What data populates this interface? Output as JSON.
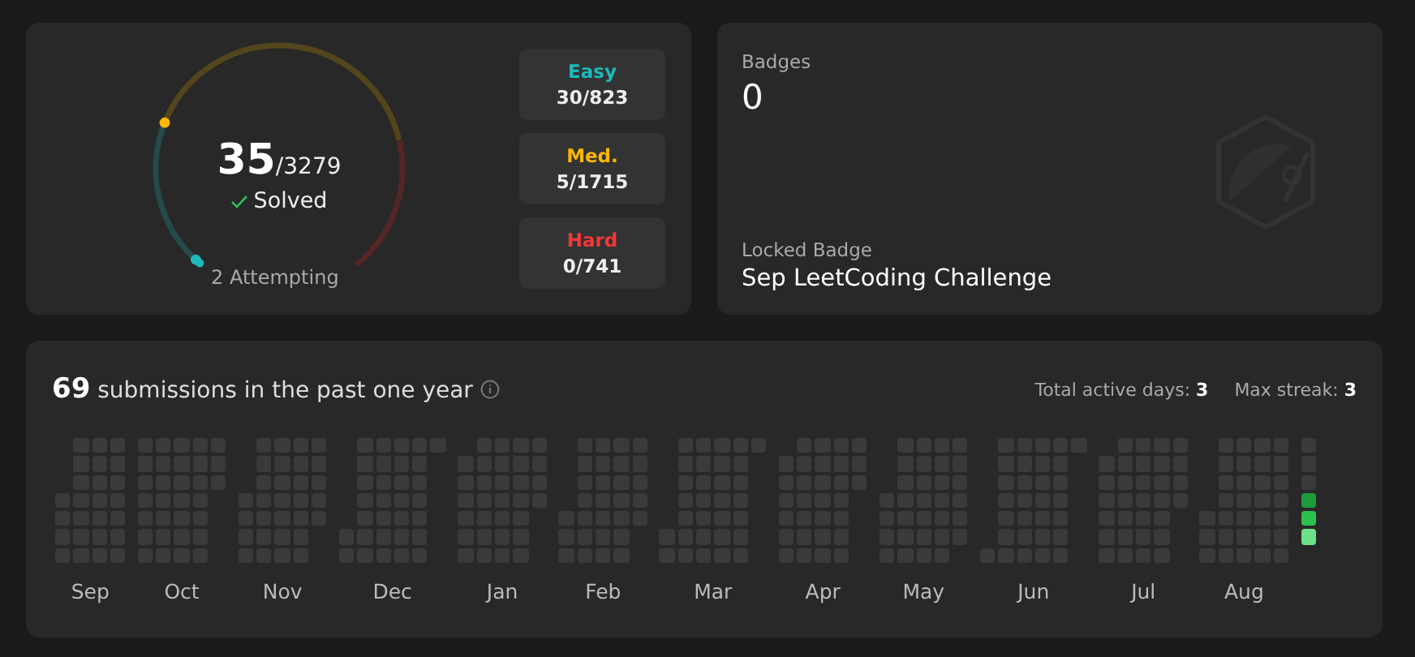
{
  "solved": {
    "count": "35",
    "total": "/3279",
    "label": "Solved",
    "attempting": "2 Attempting",
    "difficulties": [
      {
        "kind": "easy",
        "label": "Easy",
        "value": "30/823"
      },
      {
        "kind": "medium",
        "label": "Med.",
        "value": "5/1715"
      },
      {
        "kind": "hard",
        "label": "Hard",
        "value": "0/741"
      }
    ]
  },
  "badges": {
    "title": "Badges",
    "count": "0",
    "locked_label": "Locked Badge",
    "locked_name": "Sep LeetCoding Challenge"
  },
  "calendar": {
    "title": "**69** submissions in the past one year",
    "total_active": "Total active days: **3**",
    "max_streak": "Max streak: **3**",
    "months": [
      {
        "label": "Sep"
      },
      {
        "label": "Oct"
      },
      {
        "label": "Nov"
      },
      {
        "label": "Dec"
      },
      {
        "label": "Jan"
      },
      {
        "label": "Feb"
      },
      {
        "label": "Mar"
      },
      {
        "label": "Apr"
      },
      {
        "label": "May"
      },
      {
        "label": "Jun"
      },
      {
        "label": "Jul"
      },
      {
        "label": "Aug"
      }
    ],
    "active_days": [
      {
        "color": "#1c9a3c"
      },
      {
        "color": "#2cc14f"
      },
      {
        "color": "#6ee08a"
      }
    ]
  }
}
